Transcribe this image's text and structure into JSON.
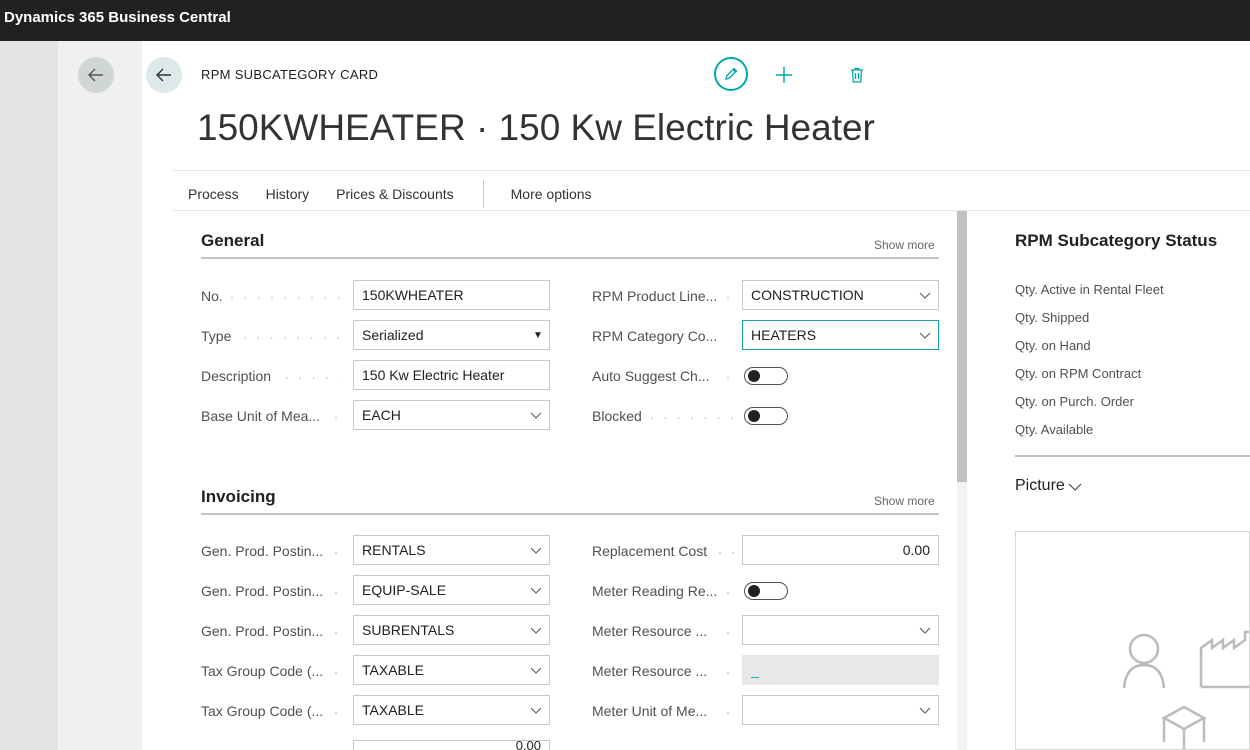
{
  "app": {
    "title": "Dynamics 365 Business Central"
  },
  "header": {
    "caption": "RPM SUBCATEGORY CARD",
    "title": "150KWHEATER · 150 Kw Electric Heater"
  },
  "actions": {
    "process": "Process",
    "history": "History",
    "prices": "Prices & Discounts",
    "more": "More options"
  },
  "general": {
    "title": "General",
    "show_more": "Show more",
    "no_label": "No.",
    "no_value": "150KWHEATER",
    "type_label": "Type",
    "type_value": "Serialized",
    "description_label": "Description",
    "description_value": "150 Kw Electric Heater",
    "base_unit_label": "Base Unit of Mea...",
    "base_unit_value": "EACH",
    "product_line_label": "RPM Product Line...",
    "product_line_value": "CONSTRUCTION",
    "category_label": "RPM Category Co...",
    "category_value": "HEATERS",
    "auto_suggest_label": "Auto Suggest Ch...",
    "auto_suggest_on": false,
    "blocked_label": "Blocked",
    "blocked_on": false
  },
  "invoicing": {
    "title": "Invoicing",
    "show_more": "Show more",
    "gen_prod_1_label": "Gen. Prod. Postin...",
    "gen_prod_1_value": "RENTALS",
    "gen_prod_2_label": "Gen. Prod. Postin...",
    "gen_prod_2_value": "EQUIP-SALE",
    "gen_prod_3_label": "Gen. Prod. Postin...",
    "gen_prod_3_value": "SUBRENTALS",
    "tax_group_1_label": "Tax Group Code (...",
    "tax_group_1_value": "TAXABLE",
    "tax_group_2_label": "Tax Group Code (...",
    "tax_group_2_value": "TAXABLE",
    "replacement_cost_label": "Replacement Cost",
    "replacement_cost_value": "0.00",
    "meter_reading_label": "Meter Reading Re...",
    "meter_reading_on": false,
    "meter_resource_1_label": "Meter Resource ...",
    "meter_resource_1_value": "",
    "meter_resource_2_label": "Meter Resource ...",
    "meter_resource_2_value": "_",
    "meter_unit_label": "Meter Unit of Me...",
    "meter_unit_value": "",
    "partial_row_value": "0.00"
  },
  "factbox": {
    "title": "RPM Subcategory Status",
    "items": [
      "Qty. Active in Rental Fleet",
      "Qty. Shipped",
      "Qty. on Hand",
      "Qty. on RPM Contract",
      "Qty. on Purch. Order",
      "Qty. Available"
    ],
    "picture_title": "Picture"
  },
  "colors": {
    "accent": "#00a8a8",
    "topbar": "#212121"
  },
  "icons": [
    "back-arrow-icon",
    "edit-pencil-icon",
    "add-plus-icon",
    "delete-trash-icon",
    "chevron-down-icon",
    "person-icon",
    "factory-icon",
    "box-icon"
  ]
}
